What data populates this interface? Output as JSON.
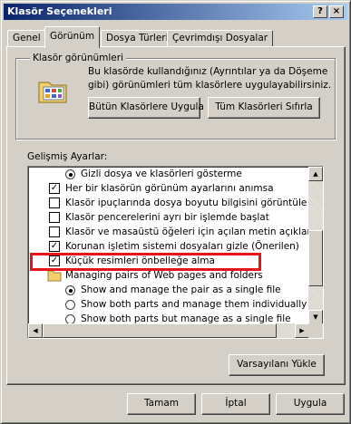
{
  "window": {
    "title": "Klasör Seçenekleri"
  },
  "titlebar_buttons": {
    "help": "?",
    "close": "×"
  },
  "tabs": [
    {
      "label": "Genel"
    },
    {
      "label": "Görünüm"
    },
    {
      "label": "Dosya Türleri"
    },
    {
      "label": "Çevrimdışı Dosyalar"
    }
  ],
  "folder_views": {
    "group_title": "Klasör görünümleri",
    "description": "Bu klasörde kullandığınız (Ayrıntılar ya da Döşeme gibi) görünümleri tüm klasörlere uygulayabilirsiniz.",
    "apply_button": "Bütün Klasörlere Uygula",
    "reset_button": "Tüm Klasörleri Sıfırla"
  },
  "advanced": {
    "label": "Gelişmiş Ayarlar:",
    "items": [
      {
        "type": "radio",
        "checked": true,
        "label": "Gizli dosya ve klasörleri gösterme"
      },
      {
        "type": "checkbox",
        "checked": true,
        "label": "Her bir klasörün görünüm ayarlarını anımsa"
      },
      {
        "type": "checkbox",
        "checked": false,
        "label": "Klasör ipuçlarında dosya boyutu bilgisini görüntüle"
      },
      {
        "type": "checkbox",
        "checked": false,
        "label": "Klasör pencerelerini ayrı bir işlemde başlat"
      },
      {
        "type": "checkbox",
        "checked": false,
        "label": "Klasör ve masaüstü öğeleri için açılan metin açıklaması gö"
      },
      {
        "type": "checkbox",
        "checked": true,
        "label": "Korunan işletim sistemi dosyaları gizle (Önerilen)"
      },
      {
        "type": "checkbox",
        "checked": true,
        "label": "Küçük resimleri önbelleğe alma"
      },
      {
        "type": "folder",
        "label": "Managing pairs of Web pages and folders"
      },
      {
        "type": "radio",
        "checked": true,
        "label": "Show and manage the pair as a single file"
      },
      {
        "type": "radio",
        "checked": false,
        "label": "Show both parts and manage them individually"
      },
      {
        "type": "radio",
        "checked": false,
        "label": "Show both parts but manage as a single file"
      }
    ],
    "highlighted_item": "Küçük resimleri önbelleğe alma"
  },
  "restore_defaults_button": "Varsayılanı Yükle",
  "footer": {
    "ok": "Tamam",
    "cancel": "İptal",
    "apply": "Uygula"
  },
  "colors": {
    "titlebar_start": "#0a246a",
    "titlebar_end": "#a6caf0",
    "highlight_box": "#e5141b",
    "dialog_face": "#d4d0c8"
  }
}
